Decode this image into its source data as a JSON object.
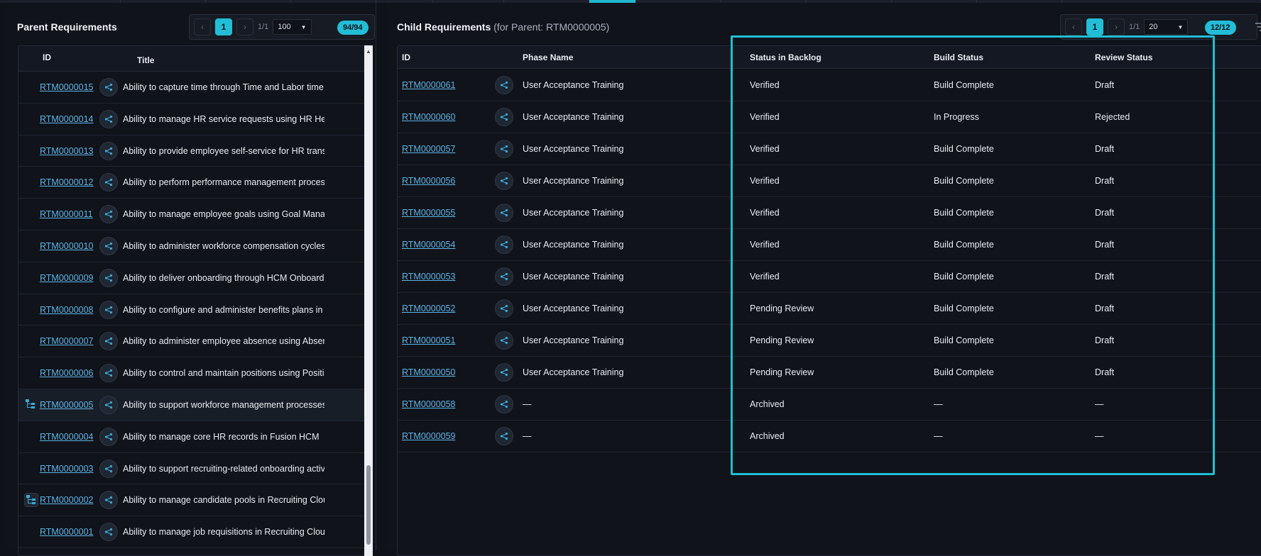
{
  "parent": {
    "title": "Parent Requirements",
    "pager": {
      "current_page": "1",
      "page_info": "1/1",
      "page_size": "100",
      "count": "94/94"
    },
    "columns": {
      "id": "ID",
      "title": "Title"
    },
    "rows": [
      {
        "id": "RTM0000015",
        "title": "Ability to capture time through Time and Labor time repo",
        "tree": "",
        "selected": false
      },
      {
        "id": "RTM0000014",
        "title": "Ability to manage HR service requests using HR Help De",
        "tree": "",
        "selected": false
      },
      {
        "id": "RTM0000013",
        "title": "Ability to provide employee self-service for HR transactio",
        "tree": "",
        "selected": false
      },
      {
        "id": "RTM0000012",
        "title": "Ability to perform performance management processes",
        "tree": "",
        "selected": false
      },
      {
        "id": "RTM0000011",
        "title": "Ability to manage employee goals using Goal Manageme",
        "tree": "",
        "selected": false
      },
      {
        "id": "RTM0000010",
        "title": "Ability to administer workforce compensation cycles",
        "tree": "",
        "selected": false
      },
      {
        "id": "RTM0000009",
        "title": "Ability to deliver onboarding through HCM Onboarding ca",
        "tree": "",
        "selected": false
      },
      {
        "id": "RTM0000008",
        "title": "Ability to configure and administer benefits plans in Bene",
        "tree": "",
        "selected": false
      },
      {
        "id": "RTM0000007",
        "title": "Ability to administer employee absence using Absence M",
        "tree": "",
        "selected": false
      },
      {
        "id": "RTM0000006",
        "title": "Ability to control and maintain positions using Position C",
        "tree": "",
        "selected": false
      },
      {
        "id": "RTM0000005",
        "title": "Ability to support workforce management processes in C",
        "tree": "hierarchy-icon",
        "selected": true
      },
      {
        "id": "RTM0000004",
        "title": "Ability to manage core HR records in Fusion HCM",
        "tree": "",
        "selected": false
      },
      {
        "id": "RTM0000003",
        "title": "Ability to support recruiting-related onboarding activities",
        "tree": "",
        "selected": false
      },
      {
        "id": "RTM0000002",
        "title": "Ability to manage candidate pools in Recruiting Cloud",
        "tree": "hierarchy-boxed-icon",
        "selected": false
      },
      {
        "id": "RTM0000001",
        "title": "Ability to manage job requisitions in Recruiting Cloud",
        "tree": "",
        "selected": false
      }
    ]
  },
  "child": {
    "title": "Child Requirements",
    "subtitle": "(for Parent: RTM0000005)",
    "pager": {
      "current_page": "1",
      "page_info": "1/1",
      "page_size": "20",
      "count": "12/12"
    },
    "columns": {
      "id": "ID",
      "phase": "Phase Name",
      "status": "Status in Backlog",
      "build": "Build Status",
      "review": "Review Status"
    },
    "rows": [
      {
        "id": "RTM0000061",
        "phase": "User Acceptance Training",
        "status": "Verified",
        "build": "Build Complete",
        "review": "Draft"
      },
      {
        "id": "RTM0000060",
        "phase": "User Acceptance Training",
        "status": "Verified",
        "build": "In Progress",
        "review": "Rejected"
      },
      {
        "id": "RTM0000057",
        "phase": "User Acceptance Training",
        "status": "Verified",
        "build": "Build Complete",
        "review": "Draft"
      },
      {
        "id": "RTM0000056",
        "phase": "User Acceptance Training",
        "status": "Verified",
        "build": "Build Complete",
        "review": "Draft"
      },
      {
        "id": "RTM0000055",
        "phase": "User Acceptance Training",
        "status": "Verified",
        "build": "Build Complete",
        "review": "Draft"
      },
      {
        "id": "RTM0000054",
        "phase": "User Acceptance Training",
        "status": "Verified",
        "build": "Build Complete",
        "review": "Draft"
      },
      {
        "id": "RTM0000053",
        "phase": "User Acceptance Training",
        "status": "Verified",
        "build": "Build Complete",
        "review": "Draft"
      },
      {
        "id": "RTM0000052",
        "phase": "User Acceptance Training",
        "status": "Pending Review",
        "build": "Build Complete",
        "review": "Draft"
      },
      {
        "id": "RTM0000051",
        "phase": "User Acceptance Training",
        "status": "Pending Review",
        "build": "Build Complete",
        "review": "Draft"
      },
      {
        "id": "RTM0000050",
        "phase": "User Acceptance Training",
        "status": "Pending Review",
        "build": "Build Complete",
        "review": "Draft"
      },
      {
        "id": "RTM0000058",
        "phase": "—",
        "status": "Archived",
        "build": "—",
        "review": "—"
      },
      {
        "id": "RTM0000059",
        "phase": "—",
        "status": "Archived",
        "build": "—",
        "review": "—"
      }
    ]
  },
  "colors": {
    "accent": "#22bdd6",
    "link": "#5cb4e6",
    "highlight_border": "#1fbfd3",
    "background": "#0f1218"
  }
}
